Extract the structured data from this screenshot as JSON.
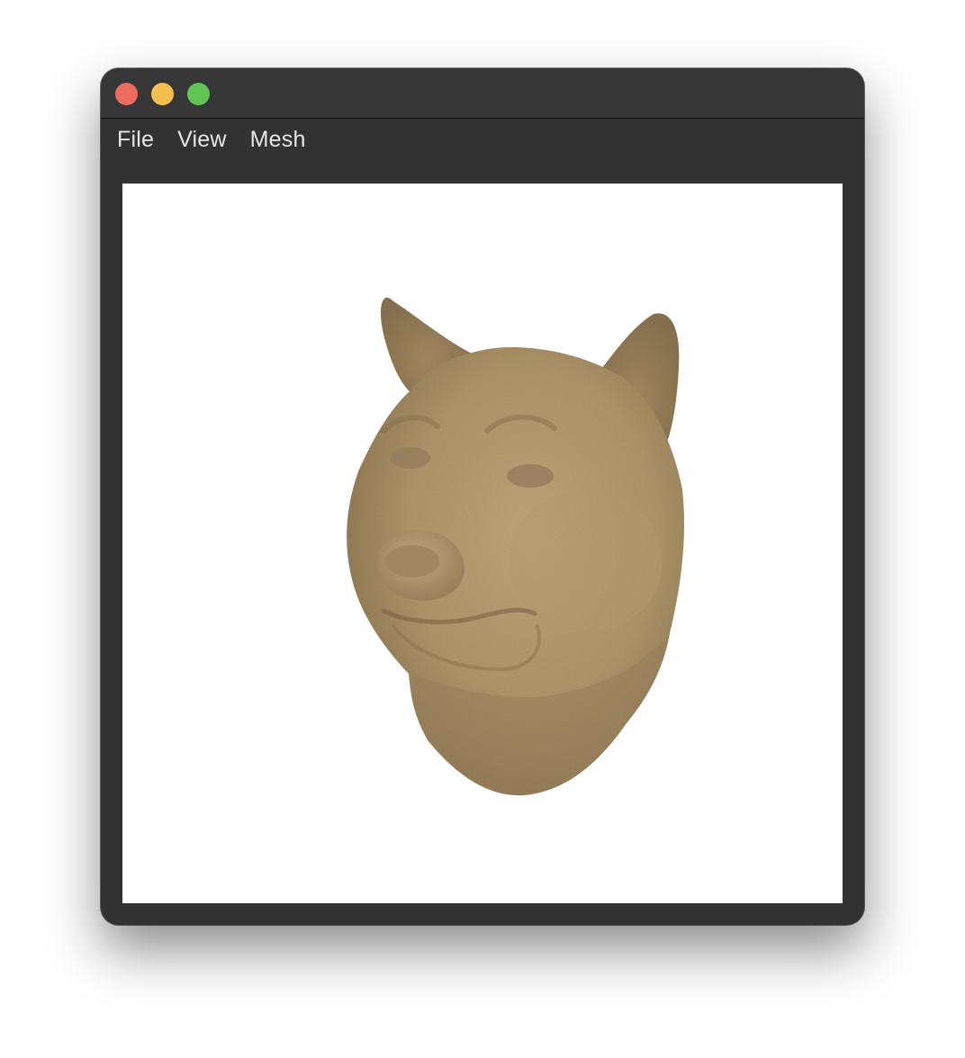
{
  "window": {
    "traffic_lights": [
      {
        "name": "close",
        "color": "#ec6a5e"
      },
      {
        "name": "minimize",
        "color": "#f4bf4f"
      },
      {
        "name": "zoom",
        "color": "#61c554"
      }
    ]
  },
  "menubar": {
    "items": [
      {
        "label": "File"
      },
      {
        "label": "View"
      },
      {
        "label": "Mesh"
      }
    ]
  },
  "viewport": {
    "background": "#ffffff",
    "mesh": {
      "subject": "cat-head-mesh",
      "color": "#b39a6e"
    }
  }
}
